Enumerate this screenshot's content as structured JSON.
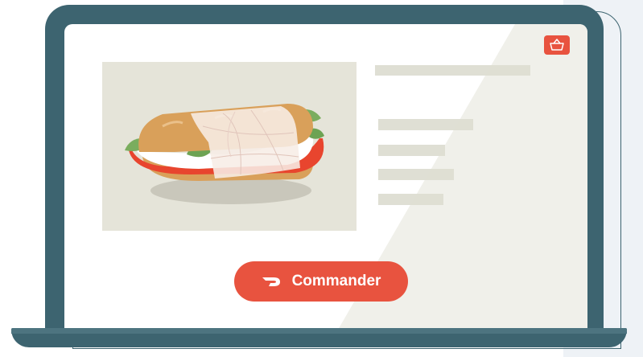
{
  "order": {
    "label": "Commander"
  },
  "icons": {
    "cart": "shopping-basket-icon",
    "brand": "dash-logo-icon"
  },
  "colors": {
    "frame": "#3d6470",
    "accent": "#e8533f",
    "image_bg": "#e5e4d9",
    "placeholder": "#ddddd2",
    "screen": "#ffffff"
  }
}
